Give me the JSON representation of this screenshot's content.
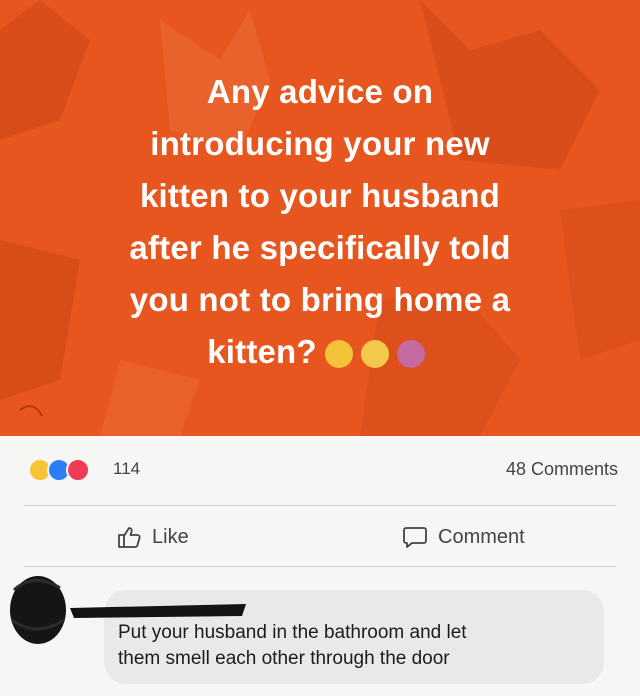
{
  "post": {
    "lines": [
      "Any advice on",
      "introducing your new",
      "kitten to your husband",
      "after he specifically told",
      "you not to bring home a",
      "kitten?"
    ],
    "emojis": [
      "scream-emoji",
      "laughing-tears-emoji",
      "shrug-emoji"
    ],
    "background_color": "#e8561f"
  },
  "stats": {
    "reaction_count": "114",
    "comments_count": "48 Comments"
  },
  "actions": {
    "like_label": "Like",
    "comment_label": "Comment"
  },
  "comment": {
    "text_line1": "Put your husband in the bathroom and let",
    "text_line2": "them smell each other through the door"
  }
}
